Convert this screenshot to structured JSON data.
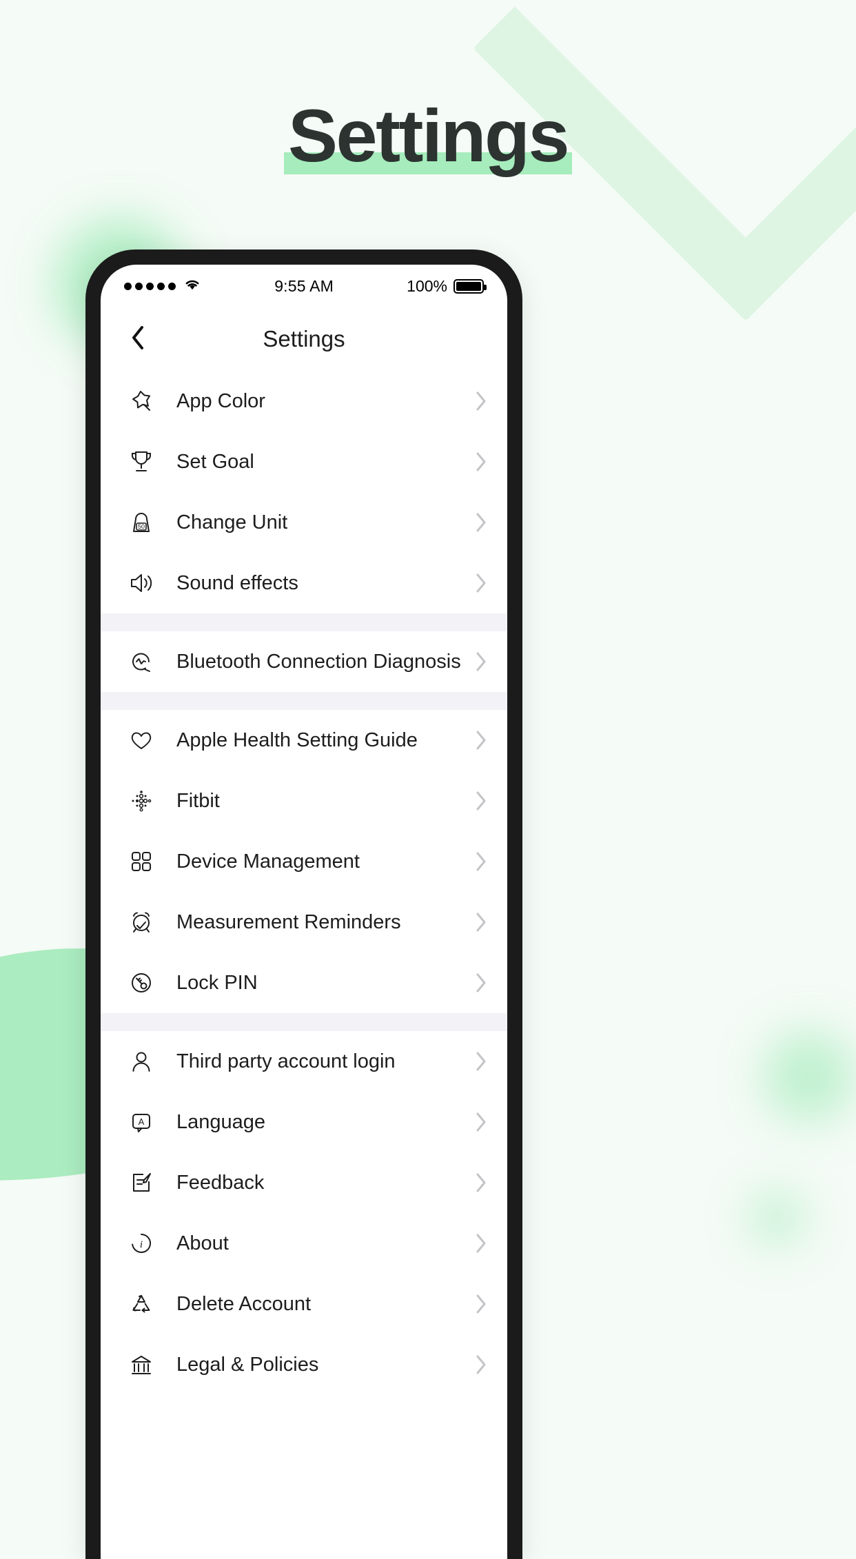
{
  "page": {
    "headline": "Settings",
    "accent_color": "#a6ecbc",
    "background_color": "#f5fbf6",
    "headline_color": "#2c3331"
  },
  "status_bar": {
    "signal_dots": 5,
    "wifi_icon": "wifi-icon",
    "time": "9:55 AM",
    "battery_percent": "100%",
    "battery_icon": "battery-full-icon"
  },
  "nav": {
    "back_icon": "chevron-left-icon",
    "title": "Settings"
  },
  "groups": [
    {
      "items": [
        {
          "label": "App Color",
          "icon": "magic-star-icon",
          "chevron": "chevron-right-icon"
        },
        {
          "label": "Set Goal",
          "icon": "trophy-icon",
          "chevron": "chevron-right-icon"
        },
        {
          "label": "Change Unit",
          "icon": "weight-scale-icon",
          "icon_text": "50",
          "chevron": "chevron-right-icon"
        },
        {
          "label": "Sound effects",
          "icon": "speaker-icon",
          "chevron": "chevron-right-icon"
        }
      ]
    },
    {
      "items": [
        {
          "label": "Bluetooth Connection Diagnosis",
          "icon": "pulse-circle-icon",
          "chevron": "chevron-right-icon"
        }
      ]
    },
    {
      "items": [
        {
          "label": "Apple Health Setting Guide",
          "icon": "heart-icon",
          "chevron": "chevron-right-icon"
        },
        {
          "label": "Fitbit",
          "icon": "fitbit-dots-icon",
          "chevron": "chevron-right-icon"
        },
        {
          "label": "Device Management",
          "icon": "grid-squares-icon",
          "chevron": "chevron-right-icon"
        },
        {
          "label": "Measurement Reminders",
          "icon": "alarm-check-icon",
          "chevron": "chevron-right-icon"
        },
        {
          "label": "Lock PIN",
          "icon": "key-circle-icon",
          "chevron": "chevron-right-icon"
        }
      ]
    },
    {
      "items": [
        {
          "label": "Third party account login",
          "icon": "person-icon",
          "chevron": "chevron-right-icon"
        },
        {
          "label": "Language",
          "icon": "language-a-icon",
          "chevron": "chevron-right-icon"
        },
        {
          "label": "Feedback",
          "icon": "edit-note-icon",
          "chevron": "chevron-right-icon"
        },
        {
          "label": "About",
          "icon": "info-icon",
          "chevron": "chevron-right-icon"
        },
        {
          "label": "Delete Account",
          "icon": "recycle-icon",
          "chevron": "chevron-right-icon"
        },
        {
          "label": "Legal & Policies",
          "icon": "bank-icon",
          "chevron": "chevron-right-icon"
        }
      ]
    }
  ]
}
